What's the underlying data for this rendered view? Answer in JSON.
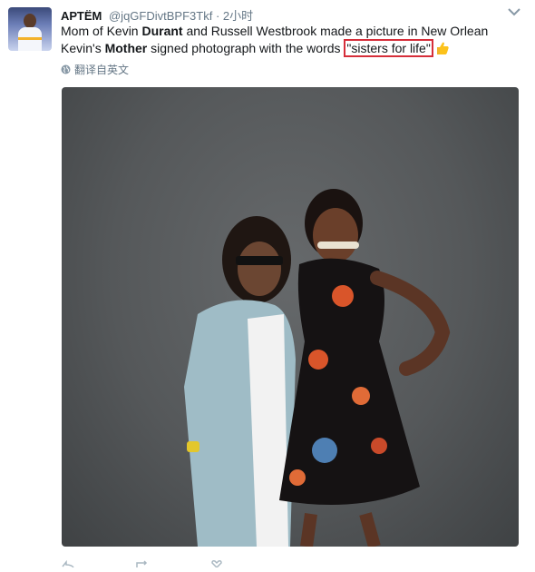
{
  "tweet": {
    "display_name": "АРТЁМ",
    "handle": "@jqGFDivtBPF3Tkf",
    "separator": "·",
    "time": "2小时",
    "text": {
      "line1_pre": "Mom of Kevin ",
      "line1_bold": "Durant",
      "line1_post": " and Russell Westbrook made a picture in New Orlean",
      "line2_pre": "Kevin's ",
      "line2_bold": "Mother",
      "line2_mid": " signed photograph with the words ",
      "line2_quote": "\"sisters for life\""
    },
    "translate_label": "翻译自英文"
  },
  "icons": {
    "avatar": "avatar-image",
    "caret": "chevron-down-icon",
    "emoji": "thumbs-up-emoji",
    "globe": "globe-icon",
    "reply": "reply-icon",
    "retweet": "retweet-icon",
    "like": "heart-icon"
  },
  "colors": {
    "text": "#14171a",
    "meta": "#657786",
    "highlight_box": "#d62e3a",
    "photo_backdrop": "#5a5d5f"
  }
}
